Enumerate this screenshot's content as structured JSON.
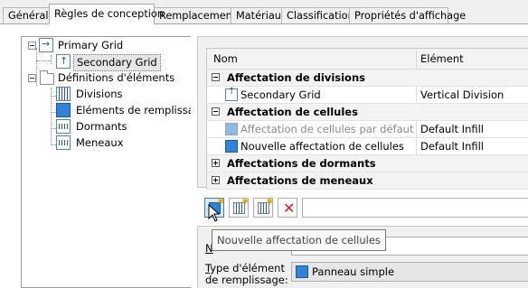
{
  "tabs": [
    {
      "label": "Général"
    },
    {
      "label": "Règles de conception"
    },
    {
      "label": "Remplacements"
    },
    {
      "label": "Matériaux"
    },
    {
      "label": "Classifications"
    },
    {
      "label": "Propriétés d'affichage"
    }
  ],
  "active_tab": "Règles de conception",
  "tree": {
    "primary_grid": "Primary Grid",
    "secondary_grid": "Secondary Grid",
    "element_definitions": "Définitions d'éléments",
    "divisions": "Divisions",
    "infills": "Eléments de remplissag",
    "frames": "Dormants",
    "mullions": "Meneaux"
  },
  "grid": {
    "headers": {
      "name": "Nom",
      "element": "Elément"
    },
    "groups": {
      "divisions": "Affectation de divisions",
      "cells": "Affectation de cellules",
      "frames": "Affectations de dormants",
      "mullions": "Affectations de meneaux"
    },
    "rows": {
      "secondary_grid": {
        "name": "Secondary Grid",
        "element": "Vertical Division"
      },
      "default_cell": {
        "name": "Affectation de cellules par défaut",
        "element": "Default Infill"
      },
      "new_cell": {
        "name": "Nouvelle affectation de cellules",
        "element": "Default Infill"
      }
    }
  },
  "toolbar": {
    "icons": [
      "add-infill-assignment-icon",
      "add-grid-assignment-icon",
      "add-assignment-icon",
      "delete-icon"
    ]
  },
  "tooltip": "Nouvelle affectation de cellules",
  "properties": {
    "name_label": "N",
    "name_value": "",
    "type_label_u": "T",
    "type_label_rest": "ype d'élément de remplissage:",
    "type_value": "Panneau simple"
  },
  "colors": {
    "infill_blue": "#2f83d8",
    "grid_blue": "#2a5aa0",
    "delete_red": "#d42020"
  }
}
